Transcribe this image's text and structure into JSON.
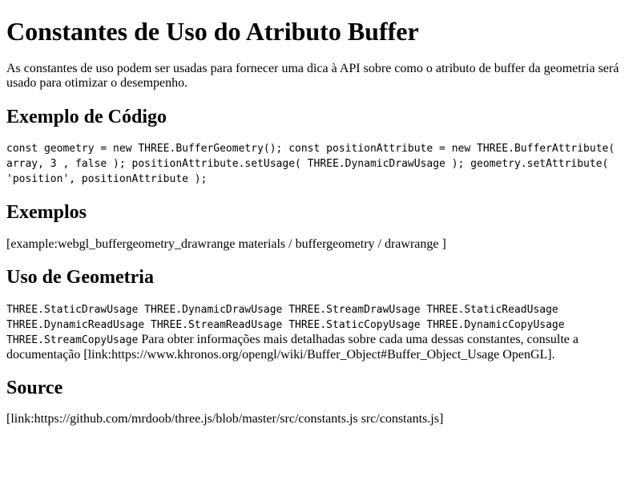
{
  "page": {
    "title": "Constantes de Uso do Atributo Buffer",
    "intro": "As constantes de uso podem ser usadas para fornecer uma dica à API sobre como o atributo de buffer da geometria será usado para otimizar o desempenho."
  },
  "code_example": {
    "heading": "Exemplo de Código",
    "code": "const geometry = new THREE.BufferGeometry(); const positionAttribute = new THREE.BufferAttribute( array, 3 , false ); positionAttribute.setUsage( THREE.DynamicDrawUsage ); geometry.setAttribute( 'position', positionAttribute );"
  },
  "examples": {
    "heading": "Exemplos",
    "text": "[example:webgl_buffergeometry_drawrange materials / buffergeometry / drawrange ]"
  },
  "geometry_usage": {
    "heading": "Uso de Geometria",
    "constants": "THREE.StaticDrawUsage THREE.DynamicDrawUsage THREE.StreamDrawUsage THREE.StaticReadUsage THREE.DynamicReadUsage THREE.StreamReadUsage THREE.StaticCopyUsage THREE.DynamicCopyUsage THREE.StreamCopyUsage",
    "description": "Para obter informações mais detalhadas sobre cada uma dessas constantes, consulte a documentação [link:https://www.khronos.org/opengl/wiki/Buffer_Object#Buffer_Object_Usage OpenGL]."
  },
  "source": {
    "heading": "Source",
    "text": "[link:https://github.com/mrdoob/three.js/blob/master/src/constants.js src/constants.js]"
  }
}
